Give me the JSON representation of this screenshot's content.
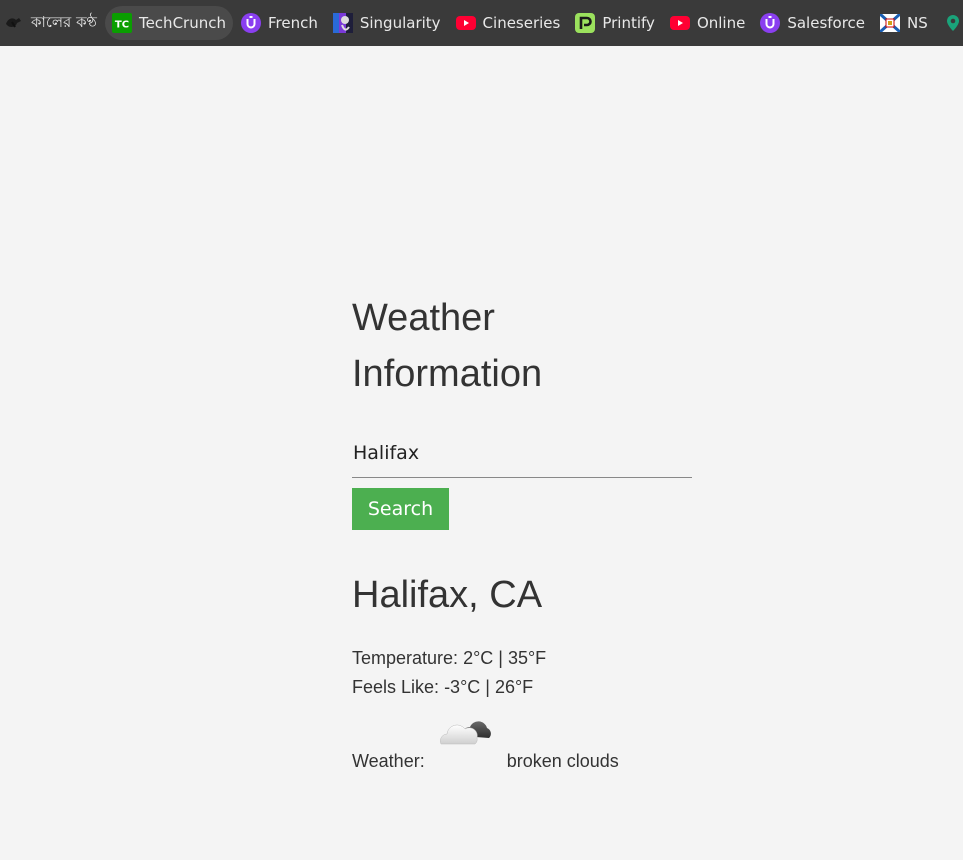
{
  "bookmarks": [
    {
      "label": "কালের কণ্ঠ",
      "icon": "kalerkantho-icon"
    },
    {
      "label": "TechCrunch",
      "icon": "techcrunch-icon"
    },
    {
      "label": "French",
      "icon": "u-icon"
    },
    {
      "label": "Singularity",
      "icon": "singularity-icon"
    },
    {
      "label": "Cineseries",
      "icon": "youtube-icon"
    },
    {
      "label": "Printify",
      "icon": "printify-icon"
    },
    {
      "label": "Online",
      "icon": "youtube-icon"
    },
    {
      "label": "Salesforce",
      "icon": "u-icon"
    },
    {
      "label": "NS",
      "icon": "ns-flag-icon"
    },
    {
      "label": "",
      "icon": "map-pin-icon"
    }
  ],
  "page": {
    "title": "Weather Information",
    "search": {
      "value": "Halifax",
      "button_label": "Search"
    },
    "result": {
      "location": "Halifax, CA",
      "temperature_label": "Temperature:",
      "temperature_value": "2°C | 35°F",
      "feels_like_label": "Feels Like:",
      "feels_like_value": "-3°C | 26°F",
      "weather_label": "Weather:",
      "weather_icon": "broken-clouds-icon",
      "weather_description": "broken clouds"
    }
  },
  "colors": {
    "bookmarks_bar": "#3a3a3a",
    "page_background": "#f4f4f4",
    "search_button": "#4caf50",
    "text": "#333333"
  }
}
